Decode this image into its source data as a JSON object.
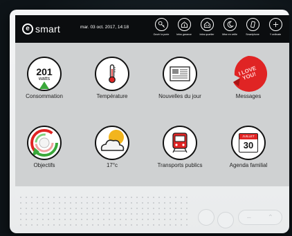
{
  "header": {
    "logo_mark": "e",
    "logo_text": "smart",
    "datetime": "mar. 03 oct. 2017, 14:18"
  },
  "actions": [
    {
      "label": "Ouvrir la porte",
      "icon": "door-key-icon"
    },
    {
      "label": "Infos garance",
      "icon": "house-info-icon"
    },
    {
      "label": "Infos quartier",
      "icon": "building-icon"
    },
    {
      "label": "Mise en veille",
      "icon": "moon-icon"
    },
    {
      "label": "Smartphone",
      "icon": "smartphone-icon"
    },
    {
      "label": "Y ordinate",
      "icon": "plus-icon"
    }
  ],
  "tiles": [
    {
      "label": "Consommation",
      "icon": "meter-icon",
      "value": "201",
      "unit": "watts"
    },
    {
      "label": "Température",
      "icon": "thermometer-icon"
    },
    {
      "label": "Nouvelles du jour",
      "icon": "newspaper-icon"
    },
    {
      "label": "Messages",
      "icon": "sticker-icon",
      "sticker_text": "I LOVE YOU!"
    },
    {
      "label": "Objectifs",
      "icon": "gauge-icon"
    },
    {
      "label": "17°c",
      "icon": "weather-icon"
    },
    {
      "label": "Transports publics",
      "icon": "train-icon"
    },
    {
      "label": "Agenda familial",
      "icon": "calendar-icon",
      "month": "JUILLET",
      "day": "30"
    }
  ],
  "pagination": {
    "pages": 3,
    "current": 1
  },
  "colors": {
    "screen_bg": "#cfd1d2",
    "topbar_bg": "#0b0d0f",
    "accent_red": "#e02424",
    "accent_green": "#3aa83a",
    "sun_yellow": "#f2b51e"
  }
}
